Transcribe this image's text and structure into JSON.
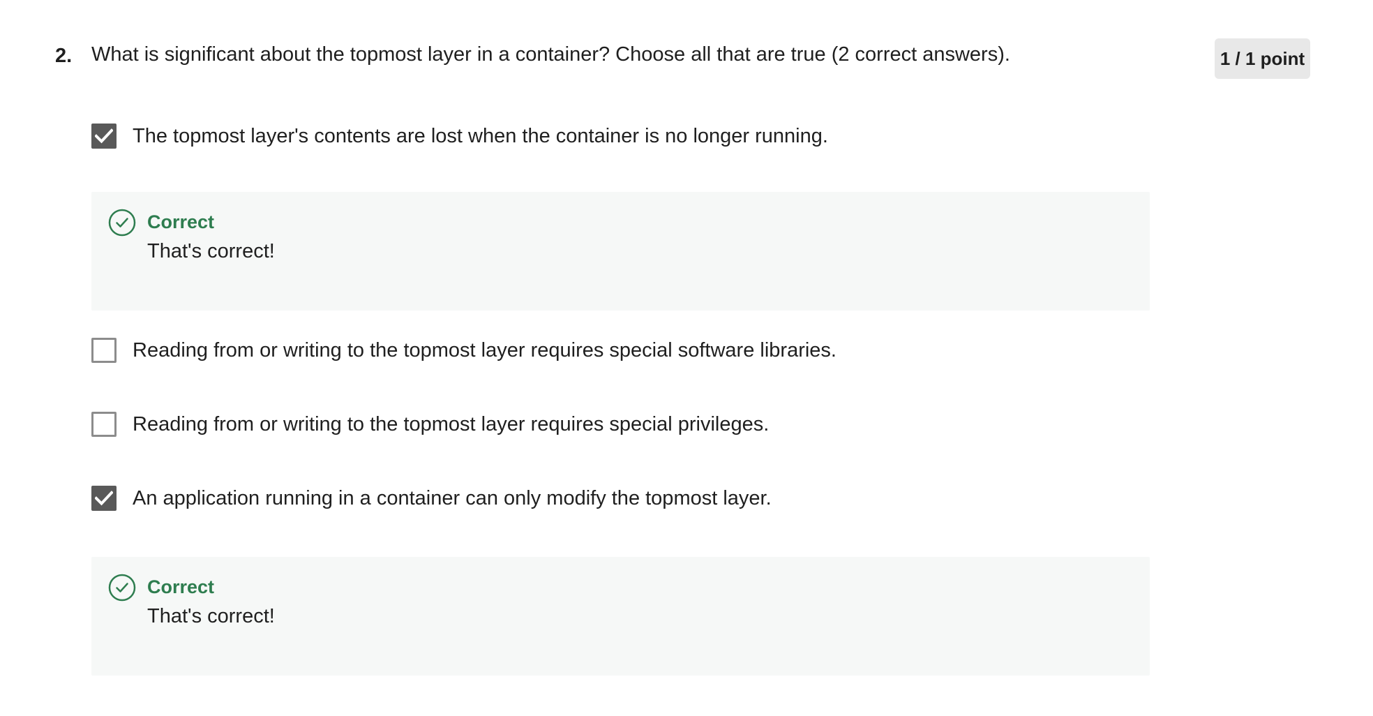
{
  "question": {
    "number": "2.",
    "prompt": "What is significant about the topmost layer in a container? Choose all that are true (2 correct answers).",
    "points": "1 / 1 point"
  },
  "options": [
    {
      "label": "The topmost layer's contents are lost when the container is no longer running.",
      "checked": true,
      "feedback": {
        "title": "Correct",
        "text": "That's correct!"
      }
    },
    {
      "label": "Reading from or writing to the topmost layer requires special software libraries.",
      "checked": false
    },
    {
      "label": "Reading from or writing to the topmost layer requires special privileges.",
      "checked": false
    },
    {
      "label": "An application running in a container can only modify the topmost layer.",
      "checked": true,
      "feedback": {
        "title": "Correct",
        "text": "That's correct!"
      }
    }
  ],
  "colors": {
    "correct_green": "#2e7d4f",
    "checkbox_checked": "#595959",
    "feedback_bg": "#f6f8f7",
    "badge_bg": "#e8e8e8"
  },
  "icons": {
    "checked_box": "check-icon",
    "feedback": "check-circle-icon"
  }
}
